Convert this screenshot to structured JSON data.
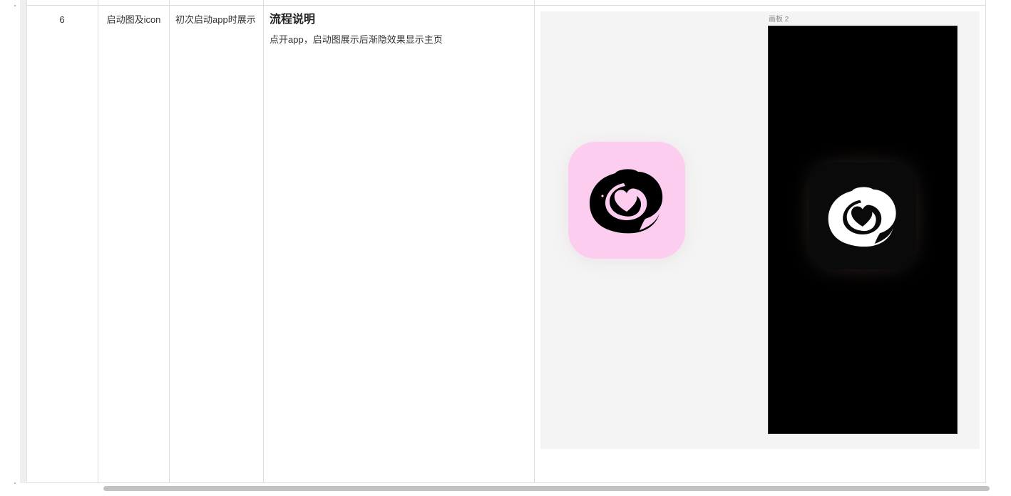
{
  "row": {
    "number": "6",
    "name": "启动图及icon",
    "scene": "初次启动app时展示",
    "description": {
      "title": "流程说明",
      "text": "点开app，启动图展示后渐隐效果显示主页"
    }
  },
  "preview": {
    "artboard_label": "画板 2",
    "light_icon": {
      "background": "#fccdee",
      "logo_color": "#000000",
      "icon": "camera-heart-logo-icon"
    },
    "dark_icon": {
      "background": "#0a0a0a",
      "logo_color": "#ffffff",
      "icon": "camera-heart-logo-icon"
    }
  },
  "colors": {
    "grid_line": "#dcdcdc",
    "preview_bg": "#f4f4f4",
    "artboard_bg": "#000000",
    "scrollbar": "#c2c2c2"
  }
}
